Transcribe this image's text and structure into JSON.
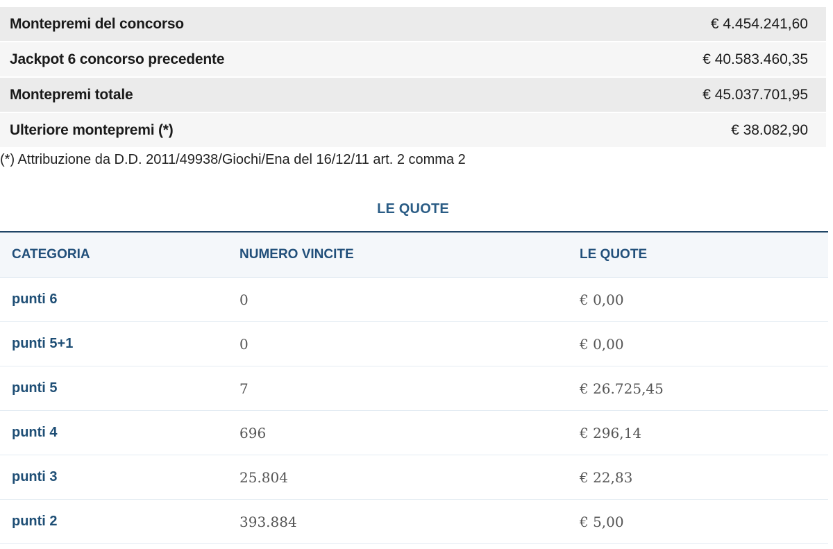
{
  "summary": [
    {
      "label": "Montepremi del concorso",
      "value": "€ 4.454.241,60"
    },
    {
      "label": "Jackpot 6 concorso precedente",
      "value": "€ 40.583.460,35"
    },
    {
      "label": "Montepremi totale",
      "value": "€ 45.037.701,95"
    },
    {
      "label": "Ulteriore montepremi (*)",
      "value": "€ 38.082,90"
    }
  ],
  "footnote": "(*) Attribuzione da D.D. 2011/49938/Giochi/Ena del 16/12/11 art. 2 comma 2",
  "quote_section": {
    "title": "LE QUOTE",
    "headers": {
      "categoria": "CATEGORIA",
      "numero_vincite": "NUMERO VINCITE",
      "le_quote": "LE QUOTE"
    },
    "rows": [
      {
        "categoria": "punti 6",
        "numero_vincite": "0",
        "quota": "€ 0,00"
      },
      {
        "categoria": "punti 5+1",
        "numero_vincite": "0",
        "quota": "€ 0,00"
      },
      {
        "categoria": "punti 5",
        "numero_vincite": "7",
        "quota": "€ 26.725,45"
      },
      {
        "categoria": "punti 4",
        "numero_vincite": "696",
        "quota": "€ 296,14"
      },
      {
        "categoria": "punti 3",
        "numero_vincite": "25.804",
        "quota": "€ 22,83"
      },
      {
        "categoria": "punti 2",
        "numero_vincite": "393.884",
        "quota": "€ 5,00"
      }
    ]
  }
}
